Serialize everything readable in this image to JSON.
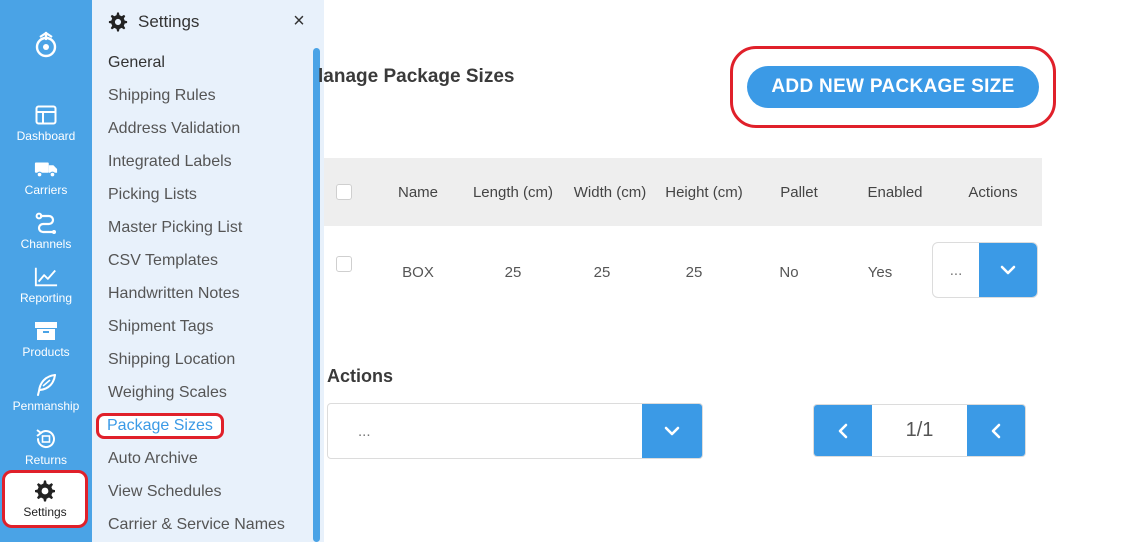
{
  "rail": {
    "items": [
      {
        "label": "Dashboard",
        "icon": "dashboard-icon"
      },
      {
        "label": "Carriers",
        "icon": "truck-icon"
      },
      {
        "label": "Channels",
        "icon": "channels-icon"
      },
      {
        "label": "Reporting",
        "icon": "chart-icon"
      },
      {
        "label": "Products",
        "icon": "box-icon"
      },
      {
        "label": "Penmanship",
        "icon": "feather-icon"
      },
      {
        "label": "Returns",
        "icon": "returns-icon"
      },
      {
        "label": "Settings",
        "icon": "gear-icon"
      }
    ]
  },
  "panel": {
    "title": "Settings",
    "close": "×",
    "items": [
      "General",
      "Shipping Rules",
      "Address Validation",
      "Integrated Labels",
      "Picking Lists",
      "Master Picking List",
      "CSV Templates",
      "Handwritten Notes",
      "Shipment Tags",
      "Shipping Location",
      "Weighing Scales",
      "Package Sizes",
      "Auto Archive",
      "View Schedules",
      "Carrier & Service Names"
    ],
    "active_item": "Package Sizes"
  },
  "main": {
    "title": "lanage Package Sizes",
    "add_button": "ADD NEW PACKAGE SIZE",
    "table": {
      "headers": [
        "Name",
        "Length (cm)",
        "Width (cm)",
        "Height (cm)",
        "Pallet",
        "Enabled",
        "Actions"
      ],
      "rows": [
        {
          "name": "BOX",
          "length": "25",
          "width": "25",
          "height": "25",
          "pallet": "No",
          "enabled": "Yes",
          "actions_value": "..."
        }
      ]
    },
    "bulk": {
      "label": "Actions",
      "value": "..."
    },
    "pager": {
      "text": "1/1"
    }
  },
  "colors": {
    "accent": "#3b9ae6",
    "rail": "#4aa3e6",
    "highlight": "#e0202a"
  }
}
